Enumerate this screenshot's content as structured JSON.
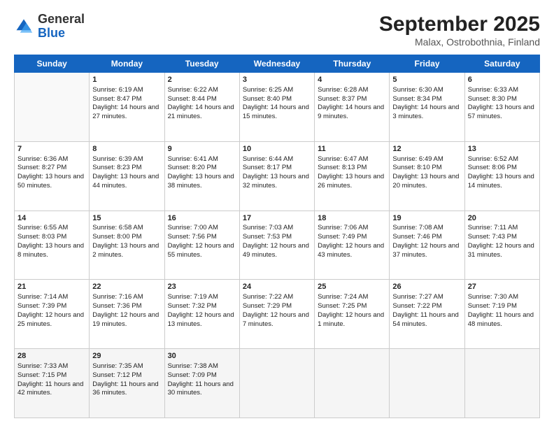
{
  "header": {
    "logo_general": "General",
    "logo_blue": "Blue",
    "month_title": "September 2025",
    "location": "Malax, Ostrobothnia, Finland"
  },
  "weekdays": [
    "Sunday",
    "Monday",
    "Tuesday",
    "Wednesday",
    "Thursday",
    "Friday",
    "Saturday"
  ],
  "weeks": [
    [
      {
        "day": "",
        "sunrise": "",
        "sunset": "",
        "daylight": ""
      },
      {
        "day": "1",
        "sunrise": "Sunrise: 6:19 AM",
        "sunset": "Sunset: 8:47 PM",
        "daylight": "Daylight: 14 hours and 27 minutes."
      },
      {
        "day": "2",
        "sunrise": "Sunrise: 6:22 AM",
        "sunset": "Sunset: 8:44 PM",
        "daylight": "Daylight: 14 hours and 21 minutes."
      },
      {
        "day": "3",
        "sunrise": "Sunrise: 6:25 AM",
        "sunset": "Sunset: 8:40 PM",
        "daylight": "Daylight: 14 hours and 15 minutes."
      },
      {
        "day": "4",
        "sunrise": "Sunrise: 6:28 AM",
        "sunset": "Sunset: 8:37 PM",
        "daylight": "Daylight: 14 hours and 9 minutes."
      },
      {
        "day": "5",
        "sunrise": "Sunrise: 6:30 AM",
        "sunset": "Sunset: 8:34 PM",
        "daylight": "Daylight: 14 hours and 3 minutes."
      },
      {
        "day": "6",
        "sunrise": "Sunrise: 6:33 AM",
        "sunset": "Sunset: 8:30 PM",
        "daylight": "Daylight: 13 hours and 57 minutes."
      }
    ],
    [
      {
        "day": "7",
        "sunrise": "Sunrise: 6:36 AM",
        "sunset": "Sunset: 8:27 PM",
        "daylight": "Daylight: 13 hours and 50 minutes."
      },
      {
        "day": "8",
        "sunrise": "Sunrise: 6:39 AM",
        "sunset": "Sunset: 8:23 PM",
        "daylight": "Daylight: 13 hours and 44 minutes."
      },
      {
        "day": "9",
        "sunrise": "Sunrise: 6:41 AM",
        "sunset": "Sunset: 8:20 PM",
        "daylight": "Daylight: 13 hours and 38 minutes."
      },
      {
        "day": "10",
        "sunrise": "Sunrise: 6:44 AM",
        "sunset": "Sunset: 8:17 PM",
        "daylight": "Daylight: 13 hours and 32 minutes."
      },
      {
        "day": "11",
        "sunrise": "Sunrise: 6:47 AM",
        "sunset": "Sunset: 8:13 PM",
        "daylight": "Daylight: 13 hours and 26 minutes."
      },
      {
        "day": "12",
        "sunrise": "Sunrise: 6:49 AM",
        "sunset": "Sunset: 8:10 PM",
        "daylight": "Daylight: 13 hours and 20 minutes."
      },
      {
        "day": "13",
        "sunrise": "Sunrise: 6:52 AM",
        "sunset": "Sunset: 8:06 PM",
        "daylight": "Daylight: 13 hours and 14 minutes."
      }
    ],
    [
      {
        "day": "14",
        "sunrise": "Sunrise: 6:55 AM",
        "sunset": "Sunset: 8:03 PM",
        "daylight": "Daylight: 13 hours and 8 minutes."
      },
      {
        "day": "15",
        "sunrise": "Sunrise: 6:58 AM",
        "sunset": "Sunset: 8:00 PM",
        "daylight": "Daylight: 13 hours and 2 minutes."
      },
      {
        "day": "16",
        "sunrise": "Sunrise: 7:00 AM",
        "sunset": "Sunset: 7:56 PM",
        "daylight": "Daylight: 12 hours and 55 minutes."
      },
      {
        "day": "17",
        "sunrise": "Sunrise: 7:03 AM",
        "sunset": "Sunset: 7:53 PM",
        "daylight": "Daylight: 12 hours and 49 minutes."
      },
      {
        "day": "18",
        "sunrise": "Sunrise: 7:06 AM",
        "sunset": "Sunset: 7:49 PM",
        "daylight": "Daylight: 12 hours and 43 minutes."
      },
      {
        "day": "19",
        "sunrise": "Sunrise: 7:08 AM",
        "sunset": "Sunset: 7:46 PM",
        "daylight": "Daylight: 12 hours and 37 minutes."
      },
      {
        "day": "20",
        "sunrise": "Sunrise: 7:11 AM",
        "sunset": "Sunset: 7:43 PM",
        "daylight": "Daylight: 12 hours and 31 minutes."
      }
    ],
    [
      {
        "day": "21",
        "sunrise": "Sunrise: 7:14 AM",
        "sunset": "Sunset: 7:39 PM",
        "daylight": "Daylight: 12 hours and 25 minutes."
      },
      {
        "day": "22",
        "sunrise": "Sunrise: 7:16 AM",
        "sunset": "Sunset: 7:36 PM",
        "daylight": "Daylight: 12 hours and 19 minutes."
      },
      {
        "day": "23",
        "sunrise": "Sunrise: 7:19 AM",
        "sunset": "Sunset: 7:32 PM",
        "daylight": "Daylight: 12 hours and 13 minutes."
      },
      {
        "day": "24",
        "sunrise": "Sunrise: 7:22 AM",
        "sunset": "Sunset: 7:29 PM",
        "daylight": "Daylight: 12 hours and 7 minutes."
      },
      {
        "day": "25",
        "sunrise": "Sunrise: 7:24 AM",
        "sunset": "Sunset: 7:25 PM",
        "daylight": "Daylight: 12 hours and 1 minute."
      },
      {
        "day": "26",
        "sunrise": "Sunrise: 7:27 AM",
        "sunset": "Sunset: 7:22 PM",
        "daylight": "Daylight: 11 hours and 54 minutes."
      },
      {
        "day": "27",
        "sunrise": "Sunrise: 7:30 AM",
        "sunset": "Sunset: 7:19 PM",
        "daylight": "Daylight: 11 hours and 48 minutes."
      }
    ],
    [
      {
        "day": "28",
        "sunrise": "Sunrise: 7:33 AM",
        "sunset": "Sunset: 7:15 PM",
        "daylight": "Daylight: 11 hours and 42 minutes."
      },
      {
        "day": "29",
        "sunrise": "Sunrise: 7:35 AM",
        "sunset": "Sunset: 7:12 PM",
        "daylight": "Daylight: 11 hours and 36 minutes."
      },
      {
        "day": "30",
        "sunrise": "Sunrise: 7:38 AM",
        "sunset": "Sunset: 7:09 PM",
        "daylight": "Daylight: 11 hours and 30 minutes."
      },
      {
        "day": "",
        "sunrise": "",
        "sunset": "",
        "daylight": ""
      },
      {
        "day": "",
        "sunrise": "",
        "sunset": "",
        "daylight": ""
      },
      {
        "day": "",
        "sunrise": "",
        "sunset": "",
        "daylight": ""
      },
      {
        "day": "",
        "sunrise": "",
        "sunset": "",
        "daylight": ""
      }
    ]
  ]
}
